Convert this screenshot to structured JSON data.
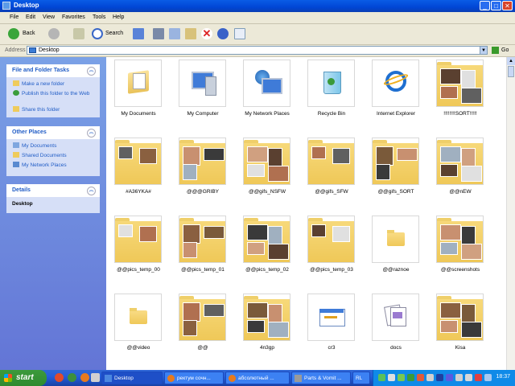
{
  "window": {
    "title": "Desktop"
  },
  "menu": [
    "File",
    "Edit",
    "View",
    "Favorites",
    "Tools",
    "Help"
  ],
  "toolbar": {
    "back": "Back",
    "search": "Search"
  },
  "address": {
    "label": "Address",
    "value": "Desktop",
    "go": "Go"
  },
  "sidebar": {
    "file_tasks": {
      "title": "File and Folder Tasks",
      "items": [
        "Make a new folder",
        "Publish this folder to the Web",
        "Share this folder"
      ]
    },
    "other_places": {
      "title": "Other Places",
      "items": [
        "My Documents",
        "Shared Documents",
        "My Network Places"
      ]
    },
    "details": {
      "title": "Details",
      "name": "Desktop"
    }
  },
  "files": [
    {
      "name": "My Documents",
      "icon": "my-documents-icon"
    },
    {
      "name": "My Computer",
      "icon": "my-computer-icon"
    },
    {
      "name": "My Network Places",
      "icon": "network-places-icon"
    },
    {
      "name": "Recycle Bin",
      "icon": "recycle-bin-icon"
    },
    {
      "name": "Internet Explorer",
      "icon": "internet-explorer-icon"
    },
    {
      "name": "!!!!!!!!SORT!!!!!",
      "icon": "thumbnail-folder-icon"
    },
    {
      "name": "#A36YKA#",
      "icon": "thumbnail-folder-icon"
    },
    {
      "name": "@@@GRIBY",
      "icon": "thumbnail-folder-icon"
    },
    {
      "name": "@@gifs_NSFW",
      "icon": "thumbnail-folder-icon"
    },
    {
      "name": "@@gifs_SFW",
      "icon": "thumbnail-folder-icon"
    },
    {
      "name": "@@gifs_SORT",
      "icon": "thumbnail-folder-icon"
    },
    {
      "name": "@@nEW",
      "icon": "thumbnail-folder-icon"
    },
    {
      "name": "@@pics_temp_00",
      "icon": "thumbnail-folder-icon"
    },
    {
      "name": "@@pics_temp_01",
      "icon": "thumbnail-folder-icon"
    },
    {
      "name": "@@pics_temp_02",
      "icon": "thumbnail-folder-icon"
    },
    {
      "name": "@@pics_temp_03",
      "icon": "thumbnail-folder-icon"
    },
    {
      "name": "@@raznoe",
      "icon": "folder-icon"
    },
    {
      "name": "@@screenshots",
      "icon": "thumbnail-folder-icon"
    },
    {
      "name": "@@video",
      "icon": "folder-icon"
    },
    {
      "name": "@@",
      "icon": "thumbnail-folder-icon"
    },
    {
      "name": "4n3gp",
      "icon": "thumbnail-folder-icon"
    },
    {
      "name": "cr3",
      "icon": "shortcut-file-icon"
    },
    {
      "name": "docs",
      "icon": "documents-file-icon"
    },
    {
      "name": "Kisa",
      "icon": "thumbnail-folder-icon"
    }
  ],
  "taskbar": {
    "start": "start",
    "tasks": [
      "Desktop",
      "ректум сочн...",
      "абсолютный ...",
      "Parts & Vomit ...",
      "RL"
    ],
    "clock": "18:37"
  },
  "colors": {
    "title_bar": "#0054e3",
    "sidebar": "#6f8de0",
    "folder": "#f3d26a",
    "taskbar": "#245edb",
    "start": "#3a943a"
  }
}
